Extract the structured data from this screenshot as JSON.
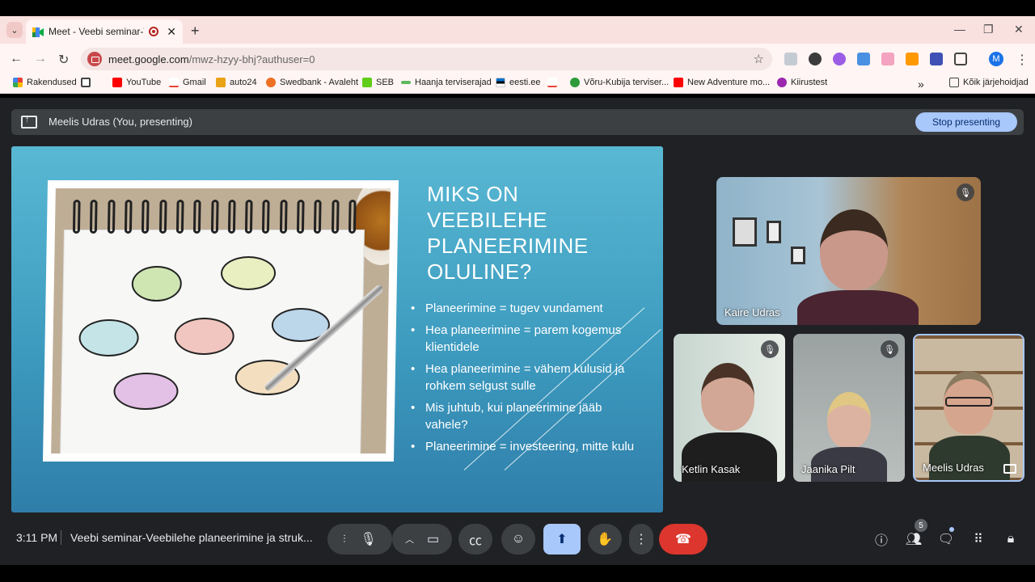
{
  "browser": {
    "tab_title": "Meet - Veebi seminar-Veeb",
    "url_host": "meet.google.com",
    "url_path": "/mwz-hzyy-bhj?authuser=0",
    "profile_initial": "M",
    "bookmarks": [
      "Rakendused",
      "YouTube",
      "Gmail",
      "auto24",
      "Swedbank - Avaleht",
      "SEB",
      "Haanja terviserajad",
      "eesti.ee",
      "Võru-Kubija terviser...",
      "New Adventure mo...",
      "Kiirustest"
    ],
    "all_bookmarks": "Kõik järjehoidjad"
  },
  "meet": {
    "presenting_label": "Meelis Udras (You, presenting)",
    "stop_presenting": "Stop presenting",
    "time": "3:11 PM",
    "meeting_title": "Veebi seminar-Veebilehe planeerimine ja struk...",
    "participant_count": "5",
    "participants": [
      "Kaire Udras",
      "Ketlin Kasak",
      "Jaanika Pilt",
      "Meelis Udras"
    ]
  },
  "slide": {
    "title": "MIKS ON VEEBILEHE PLANEERIMINE OLULINE?",
    "bullets": [
      "Planeerimine = tugev vundament",
      "Hea planeerimine = parem kogemus klientidele",
      "Hea planeerimine = vähem kulusid ja rohkem selgust sulle",
      "Mis juhtub, kui planeerimine jääb vahele?",
      "Planeerimine = investeering, mitte kulu"
    ]
  },
  "colors": {
    "accent": "#a8c7fa",
    "end_call": "#dc362e",
    "meet_bg": "#202124",
    "chrome_tab_bg": "#f9e1e0"
  }
}
